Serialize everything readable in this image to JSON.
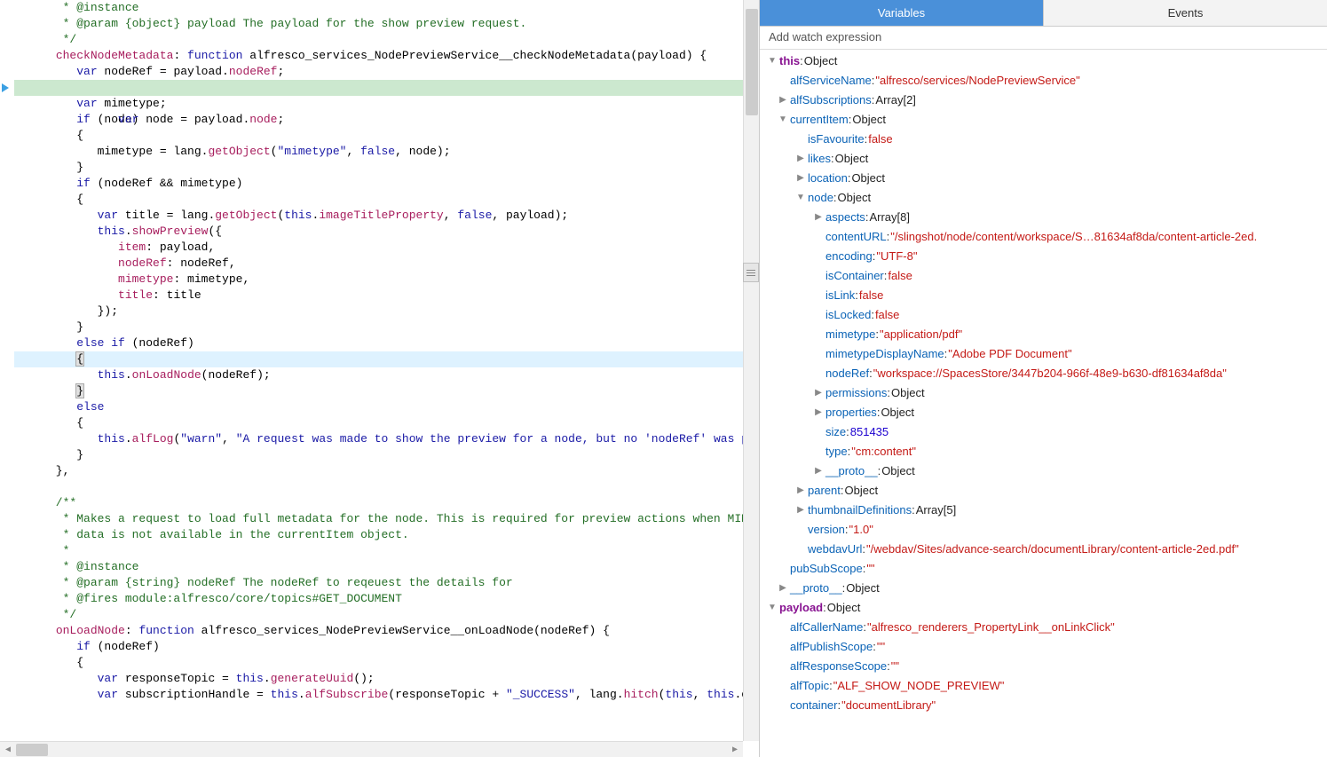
{
  "tabs": {
    "variables": "Variables",
    "events": "Events"
  },
  "watch": {
    "placeholder": "Add watch expression"
  },
  "code": {
    "l1": "       * @instance",
    "l2": "       * @param {object} payload The payload for the show preview request.",
    "l3": "       */",
    "l4a": "      ",
    "l4_key": "checkNodeMetadata",
    "l4b": ": ",
    "l4_fn": "function",
    "l4c": " alfresco_services_NodePreviewService__checkNodeMetadata(payload) {",
    "l5a": "         ",
    "l5_var": "var",
    "l5b": " nodeRef = payload.",
    "l5_prop": "nodeRef",
    "l5c": ";",
    "l6a": "         ",
    "l6_var": "var",
    "l6b": " node = payload.",
    "l6_prop": "node",
    "l6c": ";",
    "l7a": "         ",
    "l7_var": "var",
    "l7b": " mimetype;",
    "l8a": "         ",
    "l8_if": "if",
    "l8b": " (node)",
    "l9": "         {",
    "l10a": "            mimetype = lang.",
    "l10_m": "getObject",
    "l10b": "(",
    "l10_s": "\"mimetype\"",
    "l10c": ", ",
    "l10_f": "false",
    "l10d": ", node);",
    "l11": "         }",
    "l12a": "         ",
    "l12_if": "if",
    "l12b": " (nodeRef && mimetype)",
    "l13": "         {",
    "l14a": "            ",
    "l14_var": "var",
    "l14b": " title = lang.",
    "l14_m": "getObject",
    "l14c": "(",
    "l14_this": "this",
    "l14d": ".",
    "l14_p": "imageTitleProperty",
    "l14e": ", ",
    "l14_f": "false",
    "l14g": ", payload);",
    "l15a": "            ",
    "l15_this": "this",
    "l15b": ".",
    "l15_m": "showPreview",
    "l15c": "({",
    "l16a": "               ",
    "l16_k": "item",
    "l16b": ": payload,",
    "l17a": "               ",
    "l17_k": "nodeRef",
    "l17b": ": nodeRef,",
    "l18a": "               ",
    "l18_k": "mimetype",
    "l18b": ": mimetype,",
    "l19a": "               ",
    "l19_k": "title",
    "l19b": ": title",
    "l20": "            });",
    "l21": "         }",
    "l22a": "         ",
    "l22_else": "else if",
    "l22b": " (nodeRef)",
    "l23": "         {",
    "l24a": "            ",
    "l24_this": "this",
    "l24b": ".",
    "l24_m": "onLoadNode",
    "l24c": "(nodeRef);",
    "l25": "         }",
    "l26a": "         ",
    "l26_else": "else",
    "l27": "         {",
    "l28a": "            ",
    "l28_this": "this",
    "l28b": ".",
    "l28_m": "alfLog",
    "l28c": "(",
    "l28_s1": "\"warn\"",
    "l28d": ", ",
    "l28_s2": "\"A request was made to show the preview for a node, but no 'nodeRef' was p",
    "l29": "         }",
    "l30": "      },",
    "l32": "      /**",
    "l33": "       * Makes a request to load full metadata for the node. This is required for preview actions when MIM",
    "l34": "       * data is not available in the currentItem object.",
    "l35": "       *",
    "l36": "       * @instance",
    "l37": "       * @param {string} nodeRef The nodeRef to reqeuest the details for",
    "l38": "       * @fires module:alfresco/core/topics#GET_DOCUMENT",
    "l39": "       */",
    "l40a": "      ",
    "l40_key": "onLoadNode",
    "l40b": ": ",
    "l40_fn": "function",
    "l40c": " alfresco_services_NodePreviewService__onLoadNode(nodeRef) {",
    "l41a": "         ",
    "l41_if": "if",
    "l41b": " (nodeRef)",
    "l42": "         {",
    "l43a": "            ",
    "l43_var": "var",
    "l43b": " responseTopic = ",
    "l43_this": "this",
    "l43c": ".",
    "l43_m": "generateUuid",
    "l43d": "();",
    "l44a": "            ",
    "l44_var": "var",
    "l44b": " subscriptionHandle = ",
    "l44_this": "this",
    "l44c": ".",
    "l44_m": "alfSubscribe",
    "l44d": "(responseTopic + ",
    "l44_s": "\"_SUCCESS\"",
    "l44e": ", lang.",
    "l44_m2": "hitch",
    "l44f": "(",
    "l44_this2": "this",
    "l44g": ", ",
    "l44_this3": "this",
    "l44h": ".o"
  },
  "tree": {
    "this": {
      "label": "this",
      "type": "Object"
    },
    "alfServiceName": {
      "key": "alfServiceName",
      "val": "\"alfresco/services/NodePreviewService\""
    },
    "alfSubscriptions": {
      "key": "alfSubscriptions",
      "type": "Array[2]"
    },
    "currentItem": {
      "key": "currentItem",
      "type": "Object"
    },
    "isFavourite": {
      "key": "isFavourite",
      "val": "false"
    },
    "likes": {
      "key": "likes",
      "type": "Object"
    },
    "location": {
      "key": "location",
      "type": "Object"
    },
    "node": {
      "key": "node",
      "type": "Object"
    },
    "aspects": {
      "key": "aspects",
      "type": "Array[8]"
    },
    "contentURL": {
      "key": "contentURL",
      "val": "\"/slingshot/node/content/workspace/S…81634af8da/content-article-2ed."
    },
    "encoding": {
      "key": "encoding",
      "val": "\"UTF-8\""
    },
    "isContainer": {
      "key": "isContainer",
      "val": "false"
    },
    "isLink": {
      "key": "isLink",
      "val": "false"
    },
    "isLocked": {
      "key": "isLocked",
      "val": "false"
    },
    "mimetype": {
      "key": "mimetype",
      "val": "\"application/pdf\""
    },
    "mimetypeDisplayName": {
      "key": "mimetypeDisplayName",
      "val": "\"Adobe PDF Document\""
    },
    "nodeRef": {
      "key": "nodeRef",
      "val": "\"workspace://SpacesStore/3447b204-966f-48e9-b630-df81634af8da\""
    },
    "permissions": {
      "key": "permissions",
      "type": "Object"
    },
    "properties": {
      "key": "properties",
      "type": "Object"
    },
    "size": {
      "key": "size",
      "val": "851435"
    },
    "type": {
      "key": "type",
      "val": "\"cm:content\""
    },
    "proto1": {
      "key": "__proto__",
      "type": "Object"
    },
    "parent": {
      "key": "parent",
      "type": "Object"
    },
    "thumbnailDefinitions": {
      "key": "thumbnailDefinitions",
      "type": "Array[5]"
    },
    "version": {
      "key": "version",
      "val": "\"1.0\""
    },
    "webdavUrl": {
      "key": "webdavUrl",
      "val": "\"/webdav/Sites/advance-search/documentLibrary/content-article-2ed.pdf\""
    },
    "pubSubScope": {
      "key": "pubSubScope",
      "val": "\"\""
    },
    "proto2": {
      "key": "__proto__",
      "type": "Object"
    },
    "payload": {
      "label": "payload",
      "type": "Object"
    },
    "alfCallerName": {
      "key": "alfCallerName",
      "val": "\"alfresco_renderers_PropertyLink__onLinkClick\""
    },
    "alfPublishScope": {
      "key": "alfPublishScope",
      "val": "\"\""
    },
    "alfResponseScope": {
      "key": "alfResponseScope",
      "val": "\"\""
    },
    "alfTopic": {
      "key": "alfTopic",
      "val": "\"ALF_SHOW_NODE_PREVIEW\""
    },
    "container": {
      "key": "container",
      "val": "\"documentLibrary\""
    }
  }
}
